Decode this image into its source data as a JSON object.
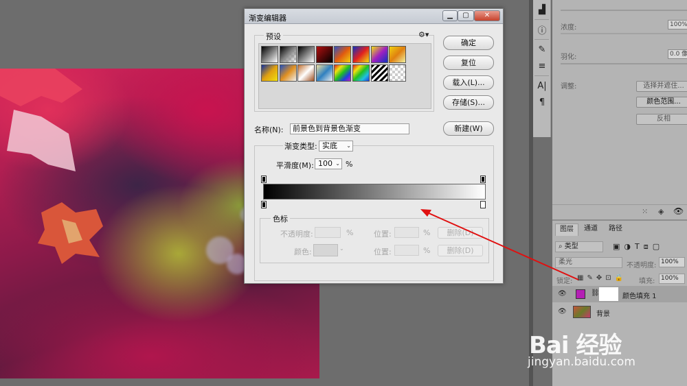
{
  "dialog": {
    "title": "渐变编辑器",
    "presets_label": "预设",
    "buttons": {
      "ok": "确定",
      "reset": "复位",
      "load": "载入(L)...",
      "save": "存储(S)...",
      "new": "新建(W)"
    },
    "name_label": "名称(N):",
    "name_value": "前景色到背景色渐变",
    "gradient_type_label": "渐变类型:",
    "gradient_type_value": "实底",
    "smoothness_label": "平滑度(M):",
    "smoothness_value": "100",
    "smoothness_unit": "%",
    "color_stops_label": "色标",
    "opacity_label": "不透明度:",
    "opacity_unit": "%",
    "position_label_1": "位置:",
    "position_unit_1": "%",
    "delete_label_1": "删除(D)",
    "color_label": "颜色:",
    "position_label_2": "位置:",
    "position_unit_2": "%",
    "delete_label_2": "删除(D)"
  },
  "properties_panel": {
    "density_label": "浓度:",
    "density_value": "100%",
    "feather_label": "羽化:",
    "feather_value": "0.0 像",
    "adjust_label": "调整:",
    "btn_select_mask": "选择并遮住...",
    "btn_color_range": "颜色范围...",
    "btn_invert": "反相"
  },
  "layers_panel": {
    "tabs": [
      "图层",
      "通道",
      "路径"
    ],
    "filter_label": "类型",
    "blend_mode": "柔光",
    "opacity_label": "不透明度:",
    "opacity_value": "100%",
    "lock_label": "锁定:",
    "fill_label": "填充:",
    "fill_value": "100%",
    "layers": [
      {
        "name": "颜色填充 1"
      },
      {
        "name": "背景"
      }
    ]
  },
  "watermark": {
    "logo": "Bai 经验",
    "url": "jingyan.baidu.com"
  },
  "colors": {
    "fill_layer_swatch": "#b41fb4",
    "arrow": "#e01010"
  }
}
